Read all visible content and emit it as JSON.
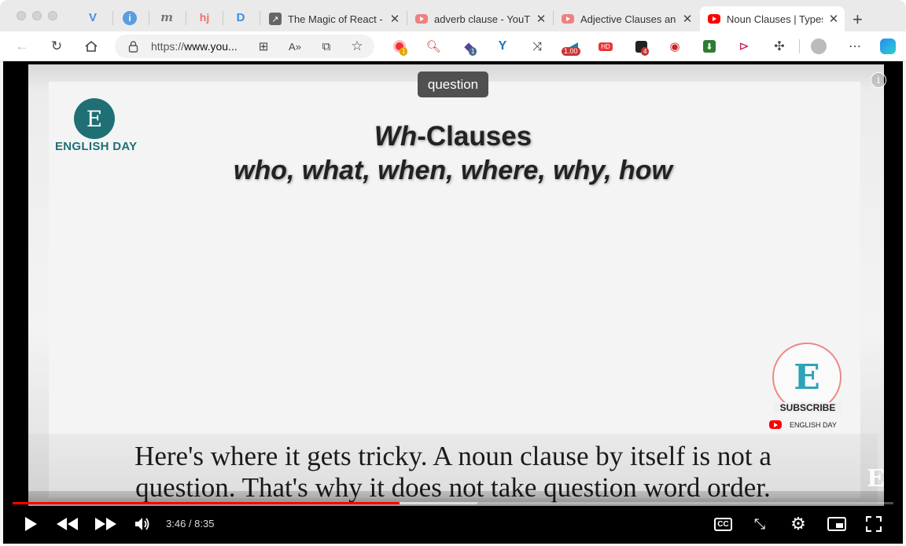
{
  "browser": {
    "pinned_tabs": [
      {
        "icon": "vee-icon",
        "glyph": "V",
        "color": "#4a8fdc"
      },
      {
        "icon": "info-tab-icon",
        "glyph": "i",
        "color": "#5a9de0"
      },
      {
        "icon": "m-icon",
        "glyph": "m",
        "color": "#777777"
      },
      {
        "icon": "hotjar-icon",
        "glyph": "hj",
        "color": "#ef6f6c"
      },
      {
        "icon": "d-icon",
        "glyph": "D",
        "color": "#3b8be8"
      }
    ],
    "tabs": [
      {
        "title": "The Magic of React -",
        "favicon": "arrow-favicon-icon",
        "active": false
      },
      {
        "title": "adverb clause - YouT",
        "favicon": "youtube-favicon-icon",
        "active": false
      },
      {
        "title": "Adjective Clauses and",
        "favicon": "youtube-favicon-icon",
        "active": false
      },
      {
        "title": "Noun Clauses | Types",
        "favicon": "youtube-favicon-icon",
        "active": true
      }
    ],
    "url_prefix": "https://",
    "url_host": "www.you...",
    "extension_badges": {
      "first": "1",
      "second": "1",
      "speed": "1.00",
      "hd": "HD",
      "count": "4"
    }
  },
  "video": {
    "tooltip": "question",
    "slide": {
      "logo_glyph": "E",
      "logo_text": "ENGLISH DAY",
      "title_italic": "Wh",
      "title_rest": "-Clauses",
      "subtitle": "who, what, when, where, why, how"
    },
    "subscribe": {
      "glyph": "E",
      "label": "SUBSCRIBE",
      "channel": "ENGLISH DAY"
    },
    "captions": [
      "Here's where it gets tricky. A noun clause by itself is not a",
      "question. That's why it does not take question word order."
    ],
    "watermark": "E",
    "player": {
      "current_time": "3:46",
      "duration": "8:35",
      "played_fraction": 0.439,
      "buffered_fraction": 0.528,
      "time_display": "3:46 / 8:35",
      "cc_label": "CC"
    }
  },
  "colors": {
    "youtube_red": "#ff0000",
    "brand_teal": "#1f6f74"
  }
}
